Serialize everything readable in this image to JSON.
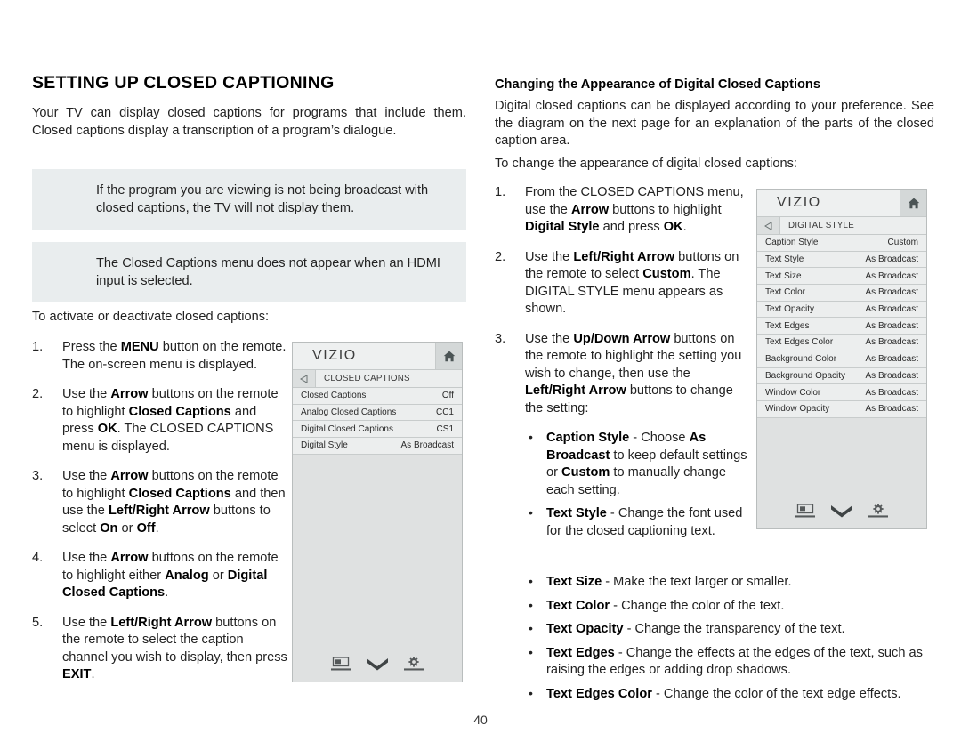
{
  "document": {
    "page_number": "40"
  },
  "left_column": {
    "title": "SETTING UP CLOSED CAPTIONING",
    "intro": "Your TV can display closed captions for programs that include them. Closed captions display a transcription of a program’s dialogue.",
    "callout_1": "If the program you are viewing is not being broadcast with closed captions, the TV will not display them.",
    "callout_2": "The Closed Captions menu does not appear when an HDMI input is selected.",
    "lead_in": "To activate or deactivate closed captions:",
    "steps": [
      {
        "num": "1.",
        "html": "Press the <b>MENU</b> button on the remote. The on-screen menu is displayed."
      },
      {
        "num": "2.",
        "html": "Use the <b>Arrow</b> buttons on the remote to highlight <b>Closed Captions</b> and press <b>OK</b>. The CLOSED CAPTIONS menu is displayed."
      },
      {
        "num": "3.",
        "html": "Use the <b>Arrow</b> buttons on the remote to highlight <b>Closed Captions</b> and then use the <b>Left/Right Arrow</b> buttons to select <b>On</b> or <b>Off</b>."
      },
      {
        "num": "4.",
        "html": "Use the <b>Arrow</b> buttons on the remote to highlight either <b>Analog</b> or <b>Digital Closed Captions</b>."
      },
      {
        "num": "5.",
        "html": "Use the <b>Left/Right Arrow</b> buttons on the remote to select the caption channel you wish to display, then press <b>EXIT</b>."
      }
    ]
  },
  "right_column": {
    "heading": "Changing the Appearance of Digital Closed Captions",
    "intro": "Digital closed captions can be displayed according to your preference. See the diagram on the next page for an explanation of the parts of the closed caption area.",
    "lead_in": "To change the appearance of digital closed captions:",
    "steps": [
      {
        "num": "1.",
        "html": "From the CLOSED CAPTIONS menu, use the <b>Arrow</b> buttons to highlight <b>Digital Style</b> and press <b>OK</b>."
      },
      {
        "num": "2.",
        "html": "Use the <b>Left/Right Arrow</b> buttons on the remote to select <b>Custom</b>. The DIGITAL STYLE menu appears as shown."
      },
      {
        "num": "3.",
        "html": "Use the <b>Up/Down Arrow</b> buttons on the remote to highlight the setting you wish to change, then use the <b>Left/Right Arrow</b> buttons to change the setting:"
      }
    ],
    "bullets_narrow": [
      {
        "html": "<b>Caption Style</b> - Choose <b>As Broadcast</b> to keep default settings or <b>Custom</b> to manually change each setting."
      },
      {
        "html": "<b>Text Style</b>  - Change the font used for the closed captioning text."
      }
    ],
    "bullets_wide": [
      {
        "html": "<b>Text Size</b> - Make the text larger or smaller."
      },
      {
        "html": "<b>Text Color</b> - Change the color of the text."
      },
      {
        "html": "<b>Text Opacity</b> - Change the transparency of the text."
      },
      {
        "html": "<b>Text Edges</b> - Change the effects at the edges of the text, such as raising the edges or adding drop shadows."
      },
      {
        "html": "<b>Text Edges Color</b> - Change the color of the text edge effects."
      }
    ]
  },
  "tv_menu_closed_captions": {
    "brand": "VIZIO",
    "breadcrumb": "CLOSED CAPTIONS",
    "rows": [
      {
        "label": "Closed Captions",
        "value": "Off"
      },
      {
        "label": "Analog Closed Captions",
        "value": "CC1"
      },
      {
        "label": "Digital Closed Captions",
        "value": "CS1"
      },
      {
        "label": "Digital Style",
        "value": "As Broadcast"
      }
    ]
  },
  "tv_menu_digital_style": {
    "brand": "VIZIO",
    "breadcrumb": "DIGITAL STYLE",
    "rows": [
      {
        "label": "Caption Style",
        "value": "Custom"
      },
      {
        "label": "Text Style",
        "value": "As Broadcast"
      },
      {
        "label": "Text Size",
        "value": "As Broadcast"
      },
      {
        "label": "Text Color",
        "value": "As Broadcast"
      },
      {
        "label": "Text Opacity",
        "value": "As Broadcast"
      },
      {
        "label": "Text Edges",
        "value": "As Broadcast"
      },
      {
        "label": "Text Edges Color",
        "value": "As Broadcast"
      },
      {
        "label": "Background Color",
        "value": "As Broadcast"
      },
      {
        "label": "Background Opacity",
        "value": "As Broadcast"
      },
      {
        "label": "Window Color",
        "value": "As Broadcast"
      },
      {
        "label": "Window Opacity",
        "value": "As Broadcast"
      }
    ]
  },
  "colors": {
    "callout_bg": "#e9edee",
    "menu_bg": "#dfe1e1",
    "menu_row_bg": "#eceeee",
    "menu_border": "#b9bdbd"
  }
}
